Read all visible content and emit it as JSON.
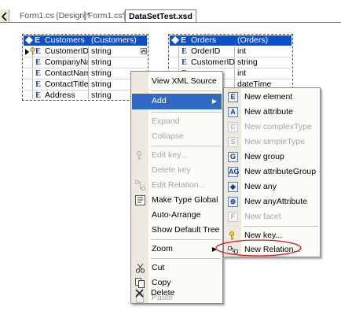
{
  "tabs": [
    {
      "label": "Form1.cs [Design]*"
    },
    {
      "label": "Form1.cs*"
    },
    {
      "label": "DataSetTest.xsd"
    }
  ],
  "customers_box": {
    "header": {
      "name": "Customers",
      "type": "(Customers)"
    },
    "rows": [
      {
        "name": "CustomerID",
        "type": "string"
      },
      {
        "name": "CompanyNa",
        "type": "string"
      },
      {
        "name": "ContactNam",
        "type": "string"
      },
      {
        "name": "ContactTitle",
        "type": "string"
      },
      {
        "name": "Address",
        "type": "string"
      }
    ]
  },
  "orders_box": {
    "header": {
      "name": "Orders",
      "type": "(Orders)"
    },
    "rows": [
      {
        "name": "OrderID",
        "type": "int"
      },
      {
        "name": "CustomerID",
        "type": "string"
      },
      {
        "name": "",
        "type": "int"
      },
      {
        "name": "",
        "type": "dateTime"
      }
    ]
  },
  "context_menu": {
    "items": [
      {
        "label": "View XML Source"
      },
      {
        "label": "Add"
      },
      {
        "label": "Expand"
      },
      {
        "label": "Collapse"
      },
      {
        "label": "Edit key..."
      },
      {
        "label": "Delete key"
      },
      {
        "label": "Edit Relation..."
      },
      {
        "label": "Make Type Global"
      },
      {
        "label": "Auto-Arrange"
      },
      {
        "label": "Show Default Tree"
      },
      {
        "label": "Zoom"
      },
      {
        "label": "Cut"
      },
      {
        "label": "Copy"
      },
      {
        "label": "Paste"
      },
      {
        "label": "Delete"
      }
    ]
  },
  "add_submenu": {
    "items": [
      {
        "label": "New element"
      },
      {
        "label": "New attribute"
      },
      {
        "label": "New complexType"
      },
      {
        "label": "New simpleType"
      },
      {
        "label": "New group"
      },
      {
        "label": "New attributeGroup"
      },
      {
        "label": "New any"
      },
      {
        "label": "New anyAttribute"
      },
      {
        "label": "New facet"
      },
      {
        "label": "New key..."
      },
      {
        "label": "New Relation..."
      }
    ]
  },
  "colors": {
    "accent_header": "#0a50c8",
    "menu_highlight": "#316ac5",
    "annotation_ellipse": "#d42020"
  }
}
